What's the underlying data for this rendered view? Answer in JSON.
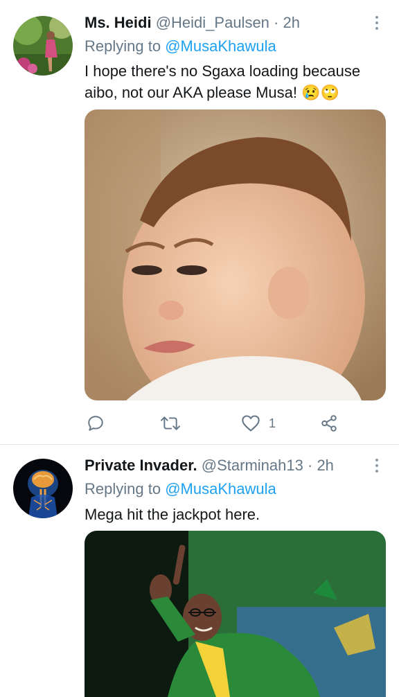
{
  "tweets": [
    {
      "display_name": "Ms. Heidi",
      "handle": "@Heidi_Paulsen",
      "separator": "·",
      "time": "2h",
      "replying_prefix": "Replying to",
      "replying_to": "@MusaKhawula",
      "text_line1": "I hope there's no Sgaxa loading because",
      "text_line2": "aibo, not our AKA please Musa! 😢🙄",
      "like_count": "1",
      "avatar_icon": "avatar-photo",
      "media_icon": "crying-baby-photo"
    },
    {
      "display_name": "Private Invader.",
      "handle": "@Starminah13",
      "separator": "·",
      "time": "2h",
      "replying_prefix": "Replying to",
      "replying_to": "@MusaKhawula",
      "text_line1": "Mega hit the jackpot here.",
      "avatar_icon": "brain-anatomy-photo",
      "media_icon": "man-pointing-photo"
    }
  ],
  "colors": {
    "link": "#1da1f2",
    "secondary_text": "#657786",
    "action_icon": "#657786",
    "divider": "#e1e8ed"
  }
}
